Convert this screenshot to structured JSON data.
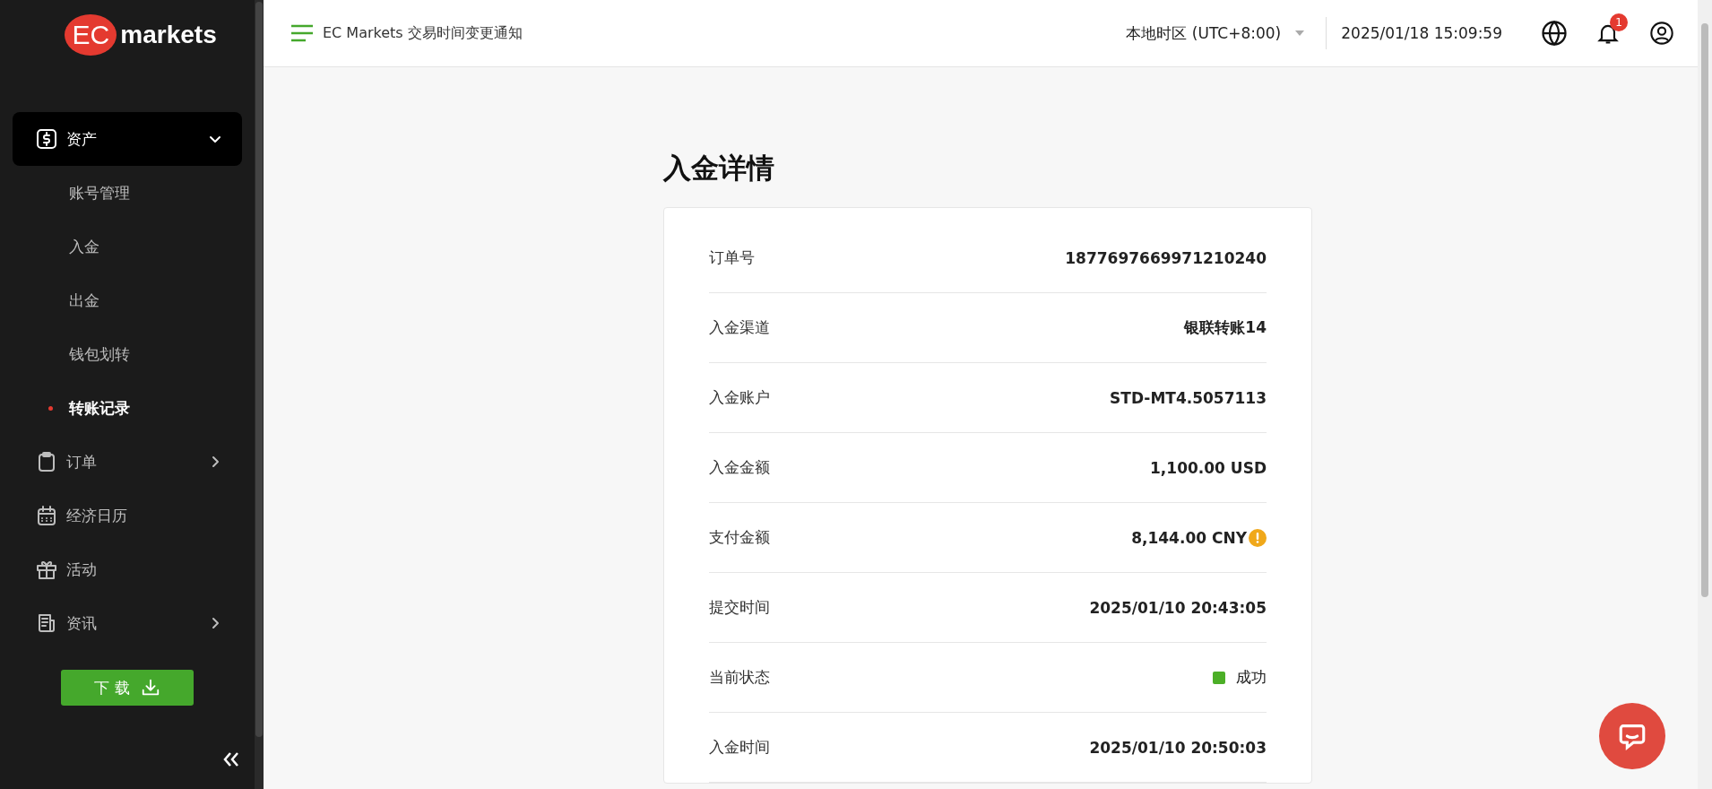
{
  "logo": {
    "mark": "EC",
    "word": "markets"
  },
  "sidebar": {
    "items": [
      {
        "kind": "group",
        "label": "资产",
        "expanded": true,
        "children": [
          {
            "label": "账号管理",
            "selected": false
          },
          {
            "label": "入金",
            "selected": false
          },
          {
            "label": "出金",
            "selected": false
          },
          {
            "label": "钱包划转",
            "selected": false
          },
          {
            "label": "转账记录",
            "selected": true
          }
        ]
      },
      {
        "kind": "group",
        "label": "订单",
        "expanded": false
      },
      {
        "kind": "link",
        "label": "经济日历"
      },
      {
        "kind": "link",
        "label": "活动"
      },
      {
        "kind": "group",
        "label": "资讯",
        "expanded": false
      }
    ],
    "download_button": "下 载"
  },
  "header": {
    "notice": "EC Markets 交易时间变更通知",
    "timezone": "本地时区 (UTC+8:00)",
    "datetime": "2025/01/18 15:09:59",
    "notification_count": "1"
  },
  "page": {
    "title": "入金详情",
    "rows": [
      {
        "kind": "text",
        "label": "订单号",
        "value": "1877697669971210240"
      },
      {
        "kind": "text",
        "label": "入金渠道",
        "value": "银联转账14"
      },
      {
        "kind": "text",
        "label": "入金账户",
        "value": "STD-MT4.5057113"
      },
      {
        "kind": "text",
        "label": "入金金额",
        "value": "1,100.00 USD"
      },
      {
        "kind": "warning",
        "label": "支付金额",
        "value": "8,144.00 CNY"
      },
      {
        "kind": "text",
        "label": "提交时间",
        "value": "2025/01/10 20:43:05"
      },
      {
        "kind": "status",
        "label": "当前状态",
        "value": "成功",
        "color": "#4caf27"
      },
      {
        "kind": "text",
        "label": "入金时间",
        "value": "2025/01/10 20:50:03"
      }
    ]
  }
}
